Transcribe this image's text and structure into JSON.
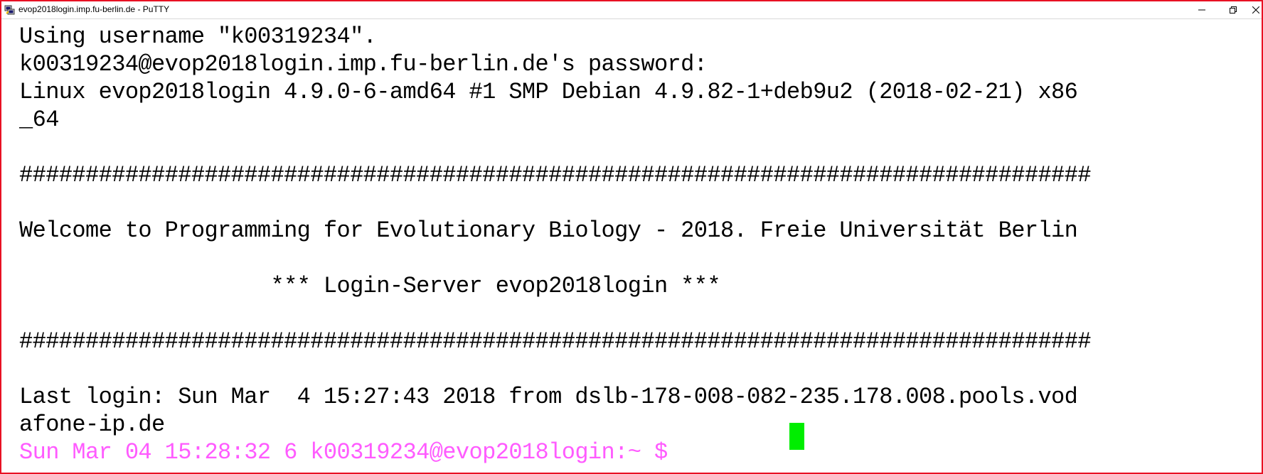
{
  "window": {
    "title": "evop2018login.imp.fu-berlin.de - PuTTY",
    "app_icon": "putty-icon",
    "controls": [
      "minimize-icon",
      "restore-icon",
      "close-icon"
    ]
  },
  "terminal": {
    "lines": [
      "Using username \"k00319234\".",
      "k00319234@evop2018login.imp.fu-berlin.de's password:",
      "Linux evop2018login 4.9.0-6-amd64 #1 SMP Debian 4.9.82-1+deb9u2 (2018-02-21) x86",
      "_64",
      "",
      "#################################################################################",
      "",
      "Welcome to Programming for Evolutionary Biology - 2018. Freie Universität Berlin",
      "",
      "                   *** Login-Server evop2018login ***",
      "",
      "#################################################################################",
      "",
      "Last login: Sun Mar  4 15:27:43 2018 from dslb-178-008-082-235.178.008.pools.vod",
      "afone-ip.de"
    ],
    "prompt": "Sun Mar 04 15:28:32 6 k00319234@evop2018login:~ $ ",
    "colors": {
      "foreground": "#000000",
      "background": "#ffffff",
      "prompt": "#ff5bff",
      "cursor": "#00ee00",
      "window_border": "#e81123"
    }
  }
}
